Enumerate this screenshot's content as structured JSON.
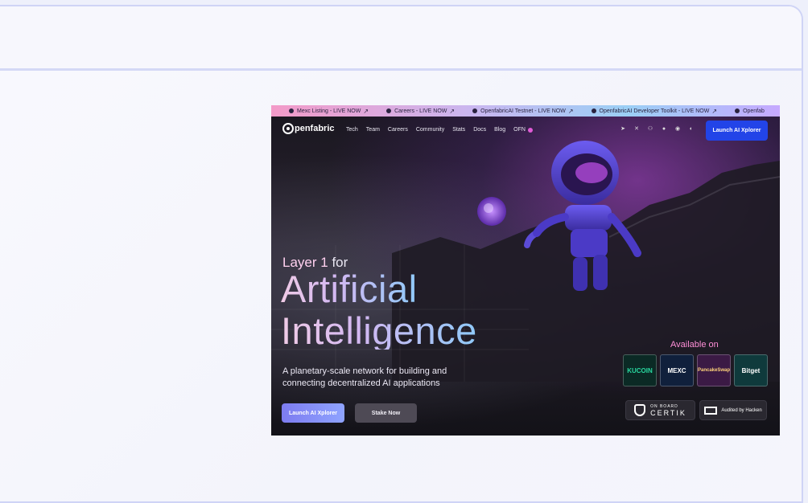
{
  "ticker": {
    "items": [
      {
        "label": "Mexc Listing - LIVE NOW",
        "arrow": "↗"
      },
      {
        "label": "Careers - LIVE NOW",
        "arrow": "↗"
      },
      {
        "label": "OpenfabricAI Testnet - LIVE NOW",
        "arrow": "↗"
      },
      {
        "label": "OpenfabricAI Developer Toolkit - LIVE NOW",
        "arrow": "↗"
      },
      {
        "label": "Openfab",
        "arrow": ""
      }
    ]
  },
  "nav": {
    "logo_text": "penfabric",
    "menu": [
      "Tech",
      "Team",
      "Careers",
      "Community",
      "Stats",
      "Docs",
      "Blog",
      "OFN"
    ],
    "socials": [
      "telegram-icon",
      "x-icon",
      "discord-icon",
      "medium-icon",
      "reddit-icon",
      "github-icon"
    ],
    "launch_label": "Launch AI Xplorer"
  },
  "hero": {
    "small_prefix": "Layer 1",
    "small_suffix": "for",
    "line1": "Artificial",
    "line2": "Intelligence",
    "subtitle": "A planetary-scale network for building and connecting decentralized AI applications",
    "primary_button": "Launch AI Xplorer",
    "secondary_button": "Stake Now"
  },
  "available": {
    "title": "Available on",
    "exchanges": [
      "KUCOIN",
      "MEXC",
      "PancakeSwap",
      "Bitget"
    ]
  },
  "audits": {
    "certik_small": "ON BOARD",
    "certik_name": "CERTIK",
    "hacken_label": "Audited by Hacken"
  },
  "colors": {
    "accent": "#2244e8",
    "frame_border": "#cfd4f6"
  }
}
